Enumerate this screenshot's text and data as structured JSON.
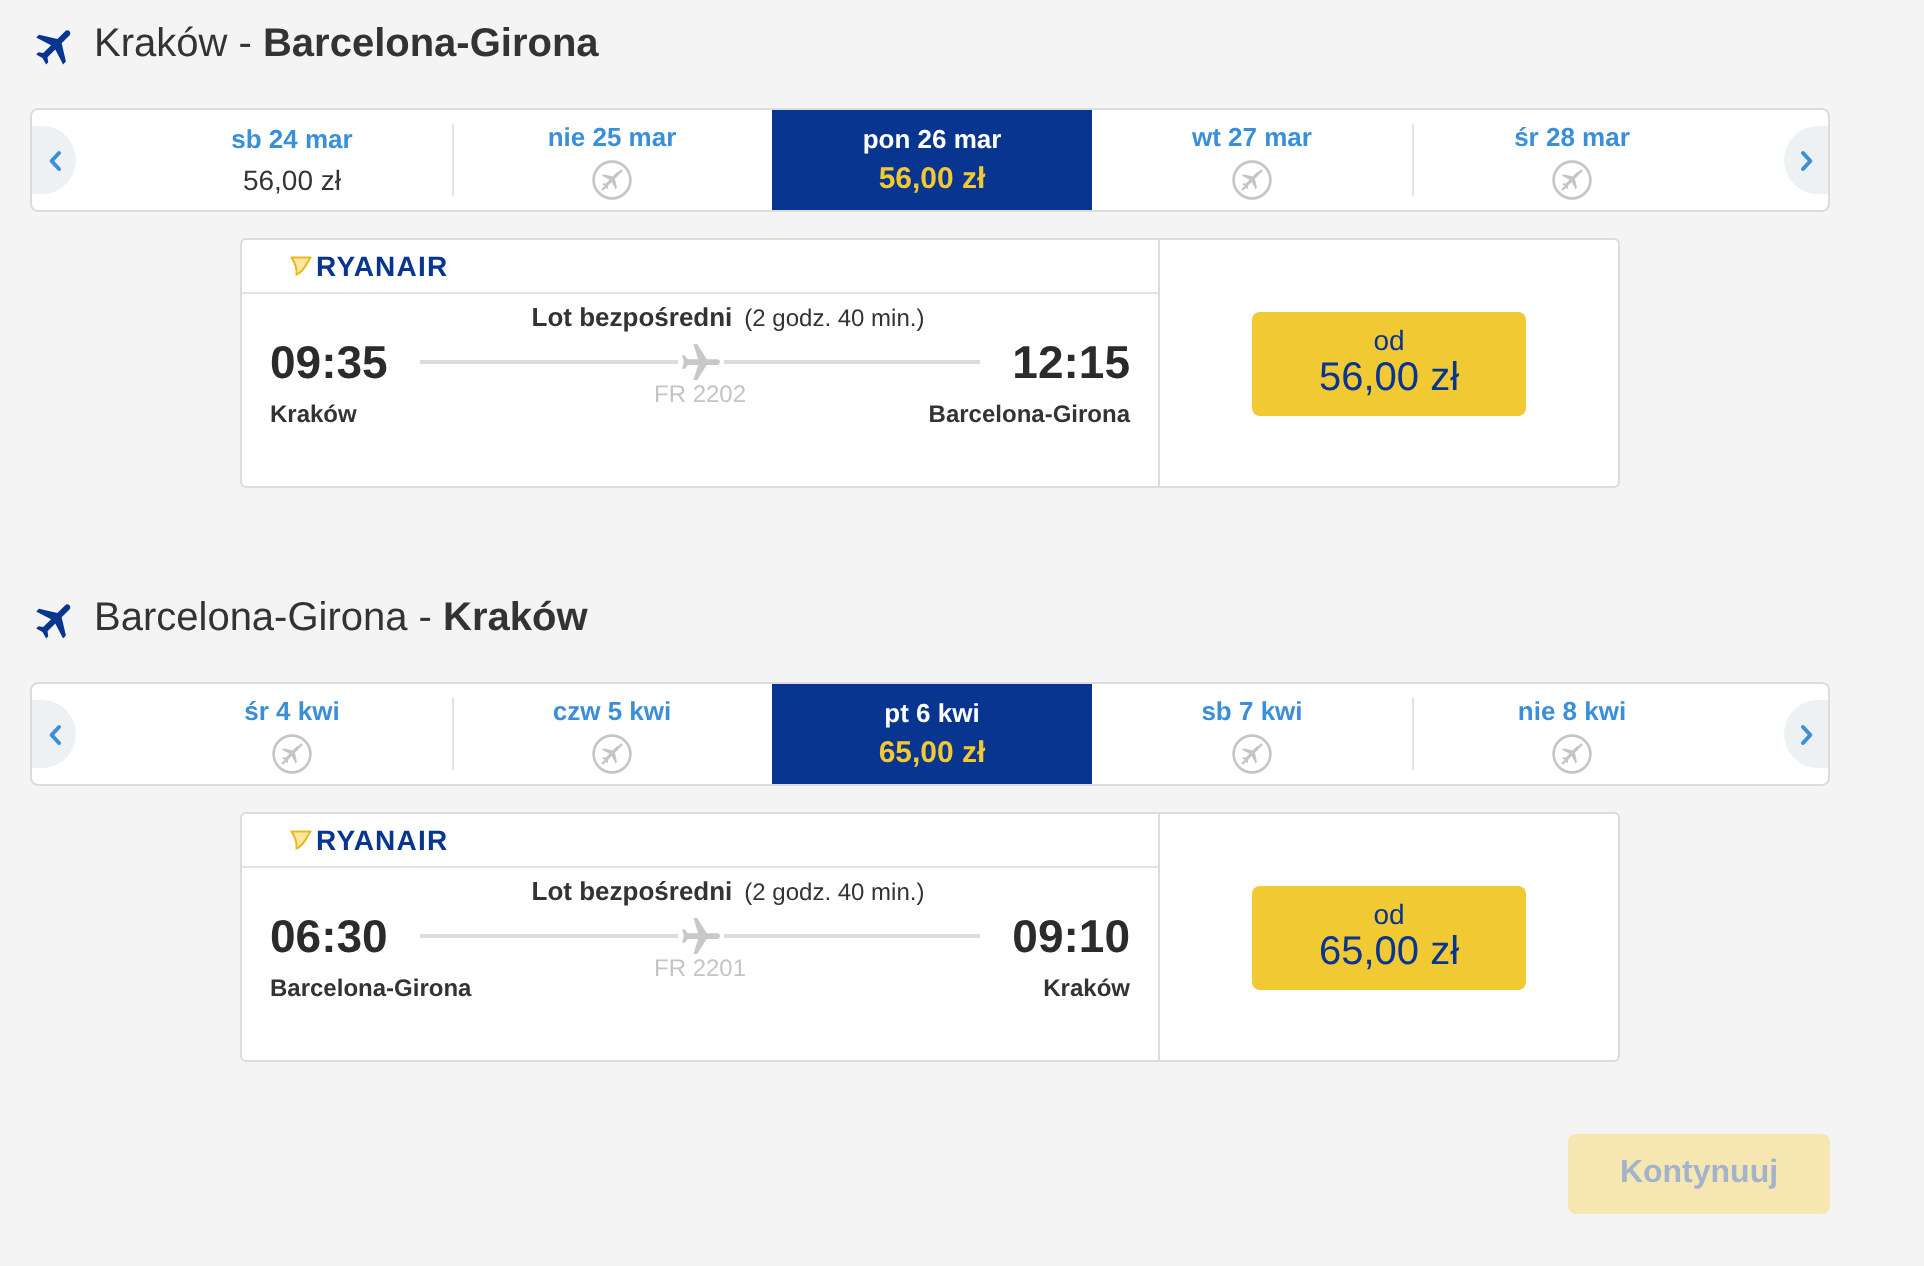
{
  "sections": [
    {
      "title": "Kraków - **Barcelona-Girona**",
      "dates": [
        {
          "day": "sb 24 mar",
          "kind": "price",
          "price": "56,00 zł",
          "selected": false
        },
        {
          "day": "nie 25 mar",
          "kind": "no_flights",
          "selected": false
        },
        {
          "day": "pon 26 mar",
          "kind": "price",
          "price": "56,00 zł",
          "selected": true
        },
        {
          "day": "wt 27 mar",
          "kind": "no_flights",
          "selected": false
        },
        {
          "day": "śr 28 mar",
          "kind": "no_flights",
          "selected": false
        }
      ],
      "flight": {
        "airline": "RYANAIR",
        "type": "Lot bezpośredni",
        "duration": "(2 godz. 40 min.)",
        "departure_time": "09:35",
        "departure_city": "Kraków",
        "flight_number": "FR 2202",
        "arrival_time": "12:15",
        "arrival_city": "Barcelona-Girona",
        "fare_prefix": "od",
        "fare": "56,00 zł"
      }
    },
    {
      "title": "Barcelona-Girona - **Kraków**",
      "dates": [
        {
          "day": "śr 4 kwi",
          "kind": "no_flights",
          "selected": false
        },
        {
          "day": "czw 5 kwi",
          "kind": "no_flights",
          "selected": false
        },
        {
          "day": "pt 6 kwi",
          "kind": "price",
          "price": "65,00 zł",
          "selected": true
        },
        {
          "day": "sb 7 kwi",
          "kind": "no_flights",
          "selected": false
        },
        {
          "day": "nie 8 kwi",
          "kind": "no_flights",
          "selected": false
        }
      ],
      "flight": {
        "airline": "RYANAIR",
        "type": "Lot bezpośredni",
        "duration": "(2 godz. 40 min.)",
        "departure_time": "06:30",
        "departure_city": "Barcelona-Girona",
        "flight_number": "FR 2201",
        "arrival_time": "09:10",
        "arrival_city": "Kraków",
        "fare_prefix": "od",
        "fare": "65,00 zł"
      }
    }
  ],
  "continue_button": {
    "label": "Kontynuuj",
    "disabled": true
  }
}
